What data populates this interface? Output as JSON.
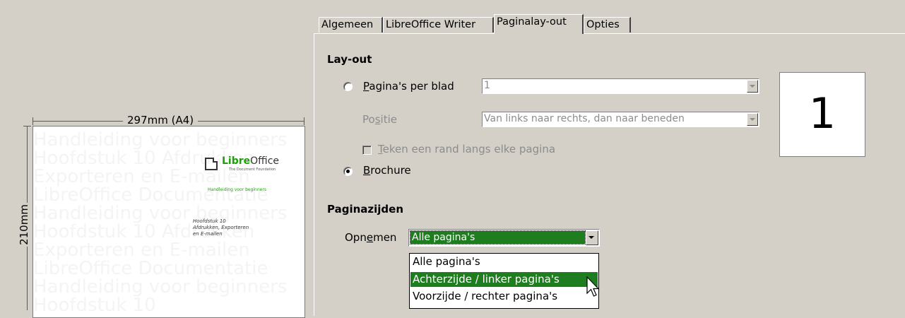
{
  "preview": {
    "width_label": "297mm (A4)",
    "height_label": "210mm",
    "watermark_lines": [
      "Handleiding voor beginners",
      "Hoofdstuk 10 Afdrukken",
      "Exporteren en E-mailen",
      "LibreOffice Documentatie",
      "Handleiding voor beginners",
      "Hoofdstuk 10 Afdrukken",
      "Exporteren en E-mailen",
      "LibreOffice Documentatie",
      "Handleiding voor beginners",
      "Hoofdstuk 10"
    ],
    "logo_libre": "Libre",
    "logo_office": "Office",
    "logo_sub": "The Document Foundation",
    "subtitle": "Handleiding voor beginners",
    "chapter_line1": "Hoofdstuk 10",
    "chapter_line2": "Afdrukken, Exporteren",
    "chapter_line3": "en E-mailen"
  },
  "tabs": [
    {
      "label": "Algemeen",
      "active": false
    },
    {
      "label": "LibreOffice Writer",
      "active": false
    },
    {
      "label": "Paginalay-out",
      "active": true
    },
    {
      "label": "Opties",
      "active": false
    }
  ],
  "layout": {
    "title": "Lay-out",
    "pages_per_sheet_label_pre": "",
    "pages_per_sheet_mnemonic": "P",
    "pages_per_sheet_label_post": "agina's per blad",
    "pages_per_sheet_value": "1",
    "position_pre": "Po",
    "position_mnemonic": "s",
    "position_post": "itie",
    "position_value": "Van links naar rechts, dan naar beneden",
    "border_mnemonic": "T",
    "border_post": "eken een rand langs elke pagina",
    "brochure_mnemonic": "B",
    "brochure_post": "rochure",
    "preview_number": "1"
  },
  "pagesides": {
    "title": "Paginazijden",
    "include_pre": "Opn",
    "include_mnemonic": "e",
    "include_post": "men",
    "include_value": "Alle pagina's",
    "options": [
      "Alle pagina's",
      "Achterzijde / linker pagina's",
      "Voorzijde / rechter pagina's"
    ],
    "highlighted_option": "Achterzijde / linker pagina's"
  },
  "colors": {
    "dialog_bg": "#d4d0c8",
    "selection": "#1e7d1e",
    "libreoffice_green": "#18a303"
  }
}
